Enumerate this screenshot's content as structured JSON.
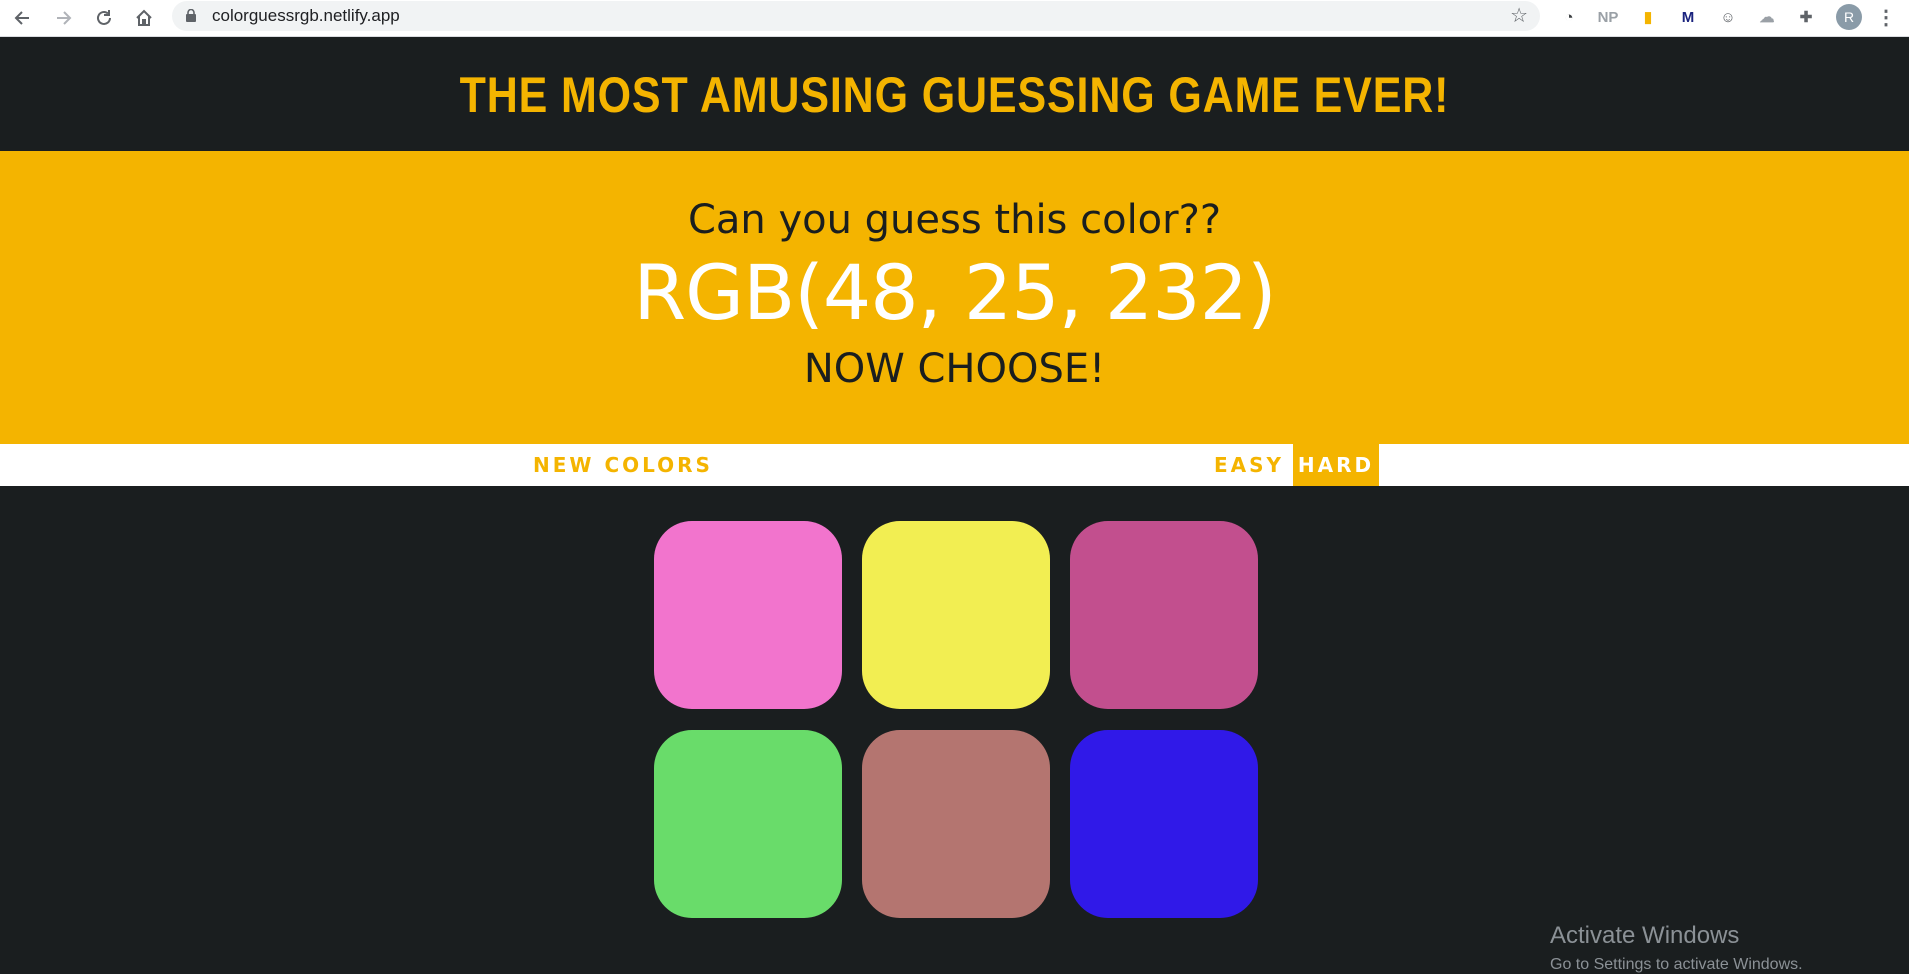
{
  "browser": {
    "url": "colorguessrgb.netlify.app",
    "back_icon": "arrow-left",
    "forward_icon": "arrow-right",
    "reload_icon": "reload",
    "home_icon": "home",
    "extensions": [
      {
        "name": "speed-gauge-icon",
        "glyph": "◔",
        "color": "#3c4043"
      },
      {
        "name": "np-extension-icon",
        "glyph": "NP",
        "color": "#9aa0a6"
      },
      {
        "name": "bookmark-extension-icon",
        "glyph": "▮",
        "color": "#f4b400"
      },
      {
        "name": "m-extension-icon",
        "glyph": "M",
        "color": "#1a237e"
      },
      {
        "name": "face-extension-icon",
        "glyph": "☺",
        "color": "#5f6368"
      },
      {
        "name": "cloud-extension-icon",
        "glyph": "☁",
        "color": "#9aa0a6"
      },
      {
        "name": "puzzle-extension-icon",
        "glyph": "✚",
        "color": "#5f6368"
      }
    ],
    "profile_initial": "R"
  },
  "game": {
    "title": "THE MOST AMUSING GUESSING GAME EVER!",
    "question": "Can you guess this color??",
    "rgb_display": "RGB(48, 25, 232)",
    "status": "NOW CHOOSE!",
    "new_colors_label": "NEW COLORS",
    "easy_label": "EASY",
    "hard_label": "HARD",
    "selected_mode": "HARD",
    "accent_color": "#f4b400",
    "background_color": "#1a1e1f"
  },
  "squares": [
    {
      "color": "#f274cd"
    },
    {
      "color": "#f2ee52"
    },
    {
      "color": "#c24f8e"
    },
    {
      "color": "#69dc6a"
    },
    {
      "color": "#b47570"
    },
    {
      "color": "#3019e8"
    }
  ],
  "watermark": {
    "title": "Activate Windows",
    "subtitle": "Go to Settings to activate Windows."
  }
}
